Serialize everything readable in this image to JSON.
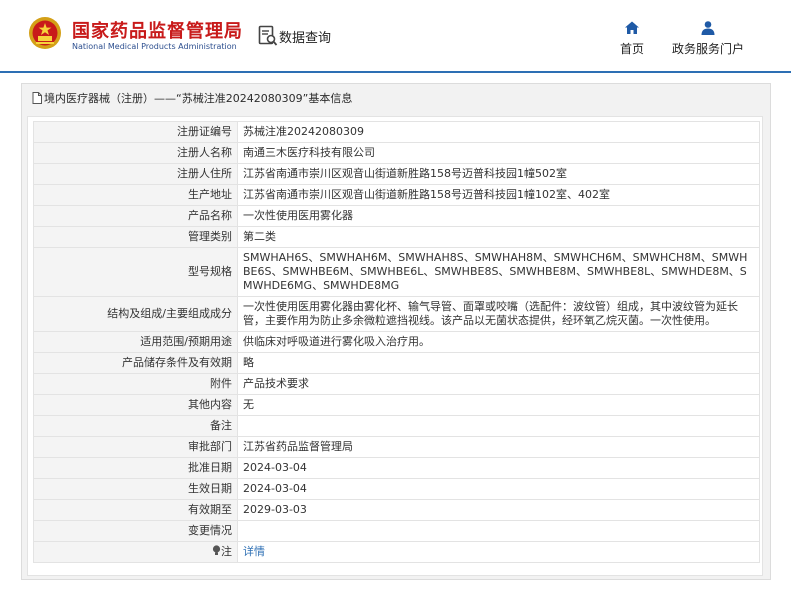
{
  "header": {
    "site_name_cn": "国家药品监督管理局",
    "site_name_en": "National Medical Products Administration",
    "query_label": "数据查询",
    "nav": [
      {
        "label": "首页",
        "icon": "home-icon"
      },
      {
        "label": "政务服务门户",
        "icon": "user-icon"
      }
    ]
  },
  "breadcrumb": {
    "text": "境内医疗器械（注册）——“苏械注准20242080309”基本信息"
  },
  "details": {
    "rows": [
      {
        "key": "注册证编号",
        "value": "苏械注准20242080309"
      },
      {
        "key": "注册人名称",
        "value": "南通三木医疗科技有限公司"
      },
      {
        "key": "注册人住所",
        "value": "江苏省南通市崇川区观音山街道新胜路158号迈普科技园1幢502室"
      },
      {
        "key": "生产地址",
        "value": "江苏省南通市崇川区观音山街道新胜路158号迈普科技园1幢102室、402室"
      },
      {
        "key": "产品名称",
        "value": "一次性使用医用雾化器"
      },
      {
        "key": "管理类别",
        "value": "第二类"
      },
      {
        "key": "型号规格",
        "value": "SMWHAH6S、SMWHAH6M、SMWHAH8S、SMWHAH8M、SMWHCH6M、SMWHCH8M、SMWHBE6S、SMWHBE6M、SMWHBE6L、SMWHBE8S、SMWHBE8M、SMWHBE8L、SMWHDE8M、SMWHDE6MG、SMWHDE8MG"
      },
      {
        "key": "结构及组成/主要组成成分",
        "value": "一次性使用医用雾化器由雾化杯、输气导管、面罩或咬嘴（选配件：波纹管）组成，其中波纹管为延长管，主要作用为防止多余微粒遮挡视线。该产品以无菌状态提供，经环氧乙烷灭菌。一次性使用。"
      },
      {
        "key": "适用范围/预期用途",
        "value": "供临床对呼吸道进行雾化吸入治疗用。"
      },
      {
        "key": "产品储存条件及有效期",
        "value": "略"
      },
      {
        "key": "附件",
        "value": "产品技术要求"
      },
      {
        "key": "其他内容",
        "value": "无"
      },
      {
        "key": "备注",
        "value": ""
      },
      {
        "key": "审批部门",
        "value": "江苏省药品监督管理局"
      },
      {
        "key": "批准日期",
        "value": "2024-03-04"
      },
      {
        "key": "生效日期",
        "value": "2024-03-04"
      },
      {
        "key": "有效期至",
        "value": "2029-03-03"
      },
      {
        "key": "变更情况",
        "value": ""
      }
    ],
    "note_label": "注",
    "note_link": "详情"
  },
  "colors": {
    "brand_red": "#c81a1a",
    "brand_blue": "#2d6fb4",
    "label_bg": "#f4f4f4",
    "panel_bg": "#f2f2f2"
  }
}
